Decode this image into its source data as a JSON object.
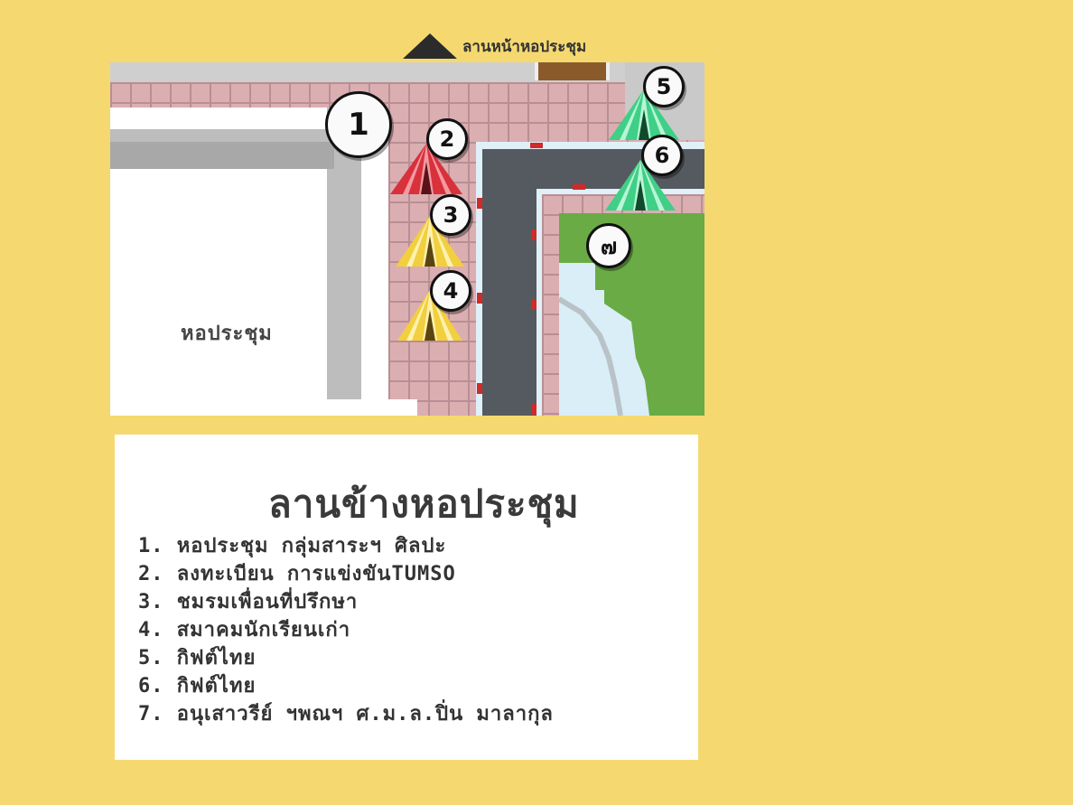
{
  "top_label": "ลานหน้าหอประชุม",
  "map": {
    "hall_label": "หอประชุม",
    "markers": [
      {
        "id": "1",
        "label": "1"
      },
      {
        "id": "2",
        "label": "2"
      },
      {
        "id": "3",
        "label": "3"
      },
      {
        "id": "4",
        "label": "4"
      },
      {
        "id": "5",
        "label": "5"
      },
      {
        "id": "6",
        "label": "6"
      },
      {
        "id": "7",
        "label": "๗"
      }
    ],
    "colors": {
      "background": "#f5d970",
      "paving": "#dbaeb2",
      "road": "#545a5f",
      "grass": "#6aab45",
      "water": "#d9eef7",
      "tent_red": "#d8313c",
      "tent_yellow": "#f2cf3e",
      "tent_green": "#3fcf86"
    }
  },
  "legend": {
    "title": "ลานข้างหอประชุม",
    "items": [
      "1. หอประชุม กลุ่มสาระฯ ศิลปะ",
      "2. ลงทะเบียน การแข่งขันTUMSO",
      "3. ชมรมเพื่อนที่ปรึกษา",
      "4. สมาคมนักเรียนเก่า",
      "5. กิฟต์ไทย",
      "6. กิฟต์ไทย",
      "7. อนุเสาวรีย์ ฯพณฯ ศ.ม.ล.ปิ่น มาลากุล"
    ]
  }
}
